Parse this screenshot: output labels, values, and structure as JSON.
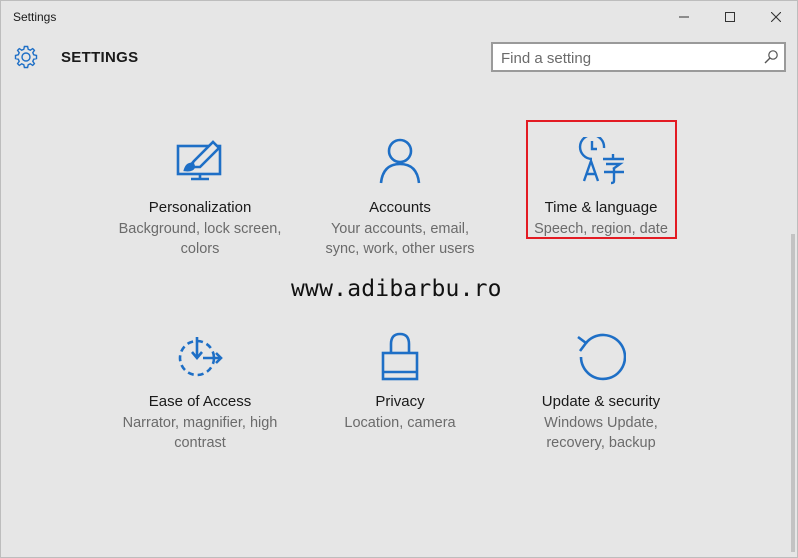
{
  "window": {
    "title": "Settings",
    "controls": {
      "minimize": "minimize-icon",
      "maximize": "maximize-icon",
      "close": "close-icon"
    }
  },
  "header": {
    "title": "SETTINGS",
    "icon": "gear-icon"
  },
  "search": {
    "placeholder": "Find a setting",
    "value": "",
    "icon": "search-icon"
  },
  "tiles": [
    {
      "id": "personalization",
      "name": "Personalization",
      "desc": "Background, lock screen, colors",
      "icon": "personalization-icon"
    },
    {
      "id": "accounts",
      "name": "Accounts",
      "desc": "Your accounts, email, sync, work, other users",
      "icon": "person-icon"
    },
    {
      "id": "time-language",
      "name": "Time & language",
      "desc": "Speech, region, date",
      "icon": "time-language-icon",
      "highlighted": true
    },
    {
      "id": "ease-of-access",
      "name": "Ease of Access",
      "desc": "Narrator, magnifier, high contrast",
      "icon": "ease-of-access-icon"
    },
    {
      "id": "privacy",
      "name": "Privacy",
      "desc": "Location, camera",
      "icon": "lock-icon"
    },
    {
      "id": "update-security",
      "name": "Update & security",
      "desc": "Windows Update, recovery, backup",
      "icon": "update-icon"
    }
  ],
  "watermark": "www.adibarbu.ro",
  "colors": {
    "accent": "#1e6fc6",
    "background": "#e6e6e6",
    "highlight": "#e31b23",
    "text": "#1a1a1a",
    "secondary_text": "#6b6b6b"
  }
}
